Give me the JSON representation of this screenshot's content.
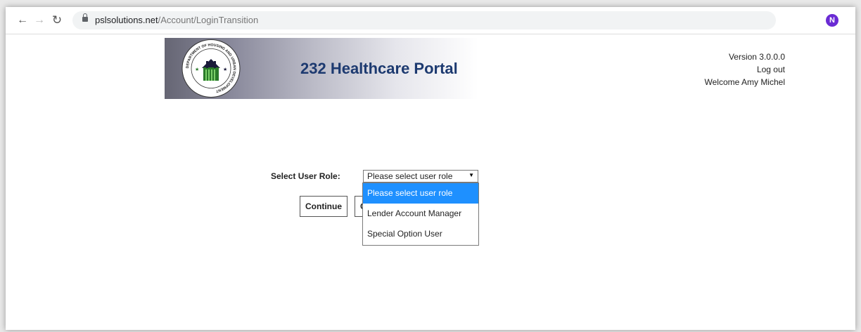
{
  "browser": {
    "url_domain": "pslsolutions.net",
    "url_path": "/Account/LoginTransition",
    "profile_initial": "N",
    "icons": {
      "back": "arrow-left-icon",
      "forward": "arrow-right-icon",
      "reload": "reload-icon",
      "lock": "lock-icon",
      "key": "key-icon",
      "bookmark": "star-icon"
    }
  },
  "header": {
    "title": "232 Healthcare Portal",
    "version": "Version 3.0.0.0",
    "logout": "Log out",
    "welcome": "Welcome Amy Michel",
    "seal_text": "DEPARTMENT OF HOUSING AND URBAN DEVELOPMENT"
  },
  "form": {
    "role_label": "Select User Role:",
    "selected_value": "Please select user role",
    "options": [
      "Please select user role",
      "Lender Account Manager",
      "Special Option User"
    ],
    "continue_label": "Continue",
    "cancel_label": "C"
  },
  "colors": {
    "title": "#1d3a70",
    "option_highlight": "#1e90ff",
    "profile": "#6a2bd4"
  }
}
